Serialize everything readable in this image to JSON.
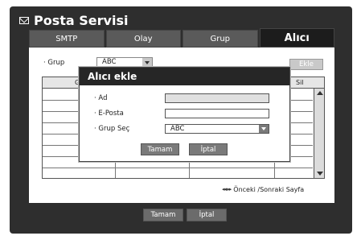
{
  "window": {
    "title": "Posta Servisi"
  },
  "tabs": [
    {
      "label": "SMTP"
    },
    {
      "label": "Olay"
    },
    {
      "label": "Grup"
    },
    {
      "label": "Alıcı"
    }
  ],
  "group_filter": {
    "label": "· Grup",
    "value": "ABC"
  },
  "add_button": {
    "label": "Ekle"
  },
  "table": {
    "headers": {
      "first": "Gr",
      "last": "Sil"
    }
  },
  "pager": {
    "icons": "◂◂ ▸▸",
    "text": "Önceki /Sonraki Sayfa"
  },
  "dialog": {
    "title": "Alıcı ekle",
    "name_label": "· Ad",
    "name_value": "",
    "email_label": "· E-Posta",
    "email_value": "",
    "group_label": "· Grup Seç",
    "group_value": "ABC",
    "ok_label": "Tamam",
    "cancel_label": "İptal"
  },
  "footer": {
    "ok_label": "Tamam",
    "cancel_label": "İptal"
  }
}
